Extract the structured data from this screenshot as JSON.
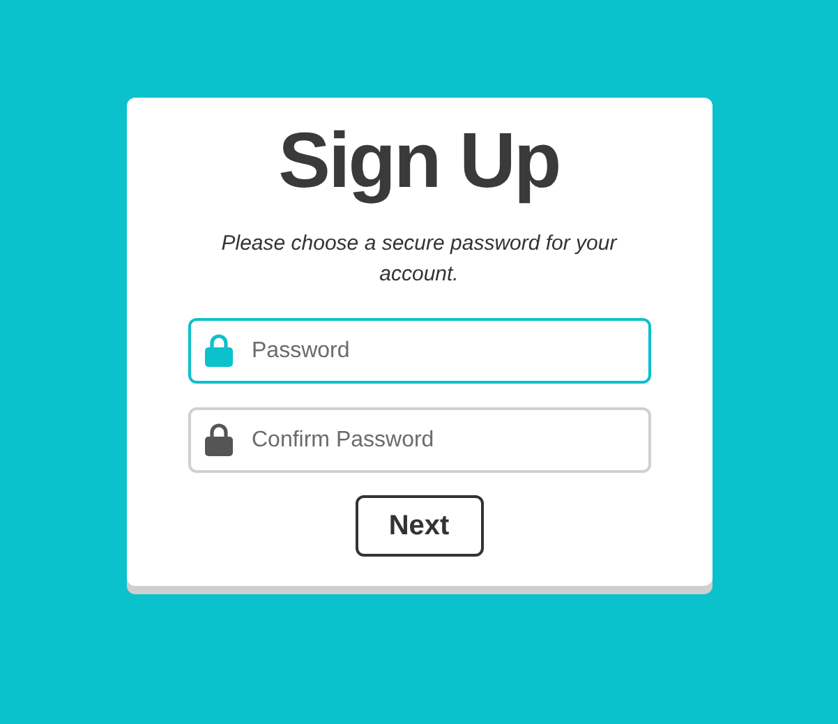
{
  "title": "Sign Up",
  "instructions": "Please choose a secure password for your account.",
  "fields": [
    {
      "placeholder": "Password",
      "focused": true
    },
    {
      "placeholder": "Confirm Password",
      "focused": false
    }
  ],
  "button": "Next"
}
